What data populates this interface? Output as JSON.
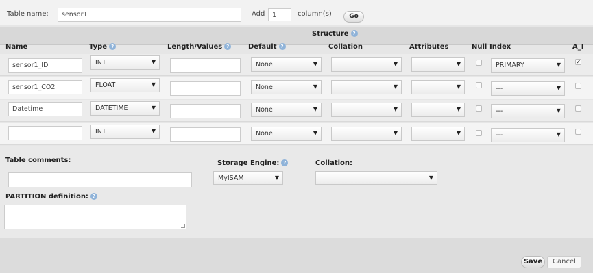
{
  "table_name": {
    "label": "Table name:",
    "value": "sensor1"
  },
  "add_columns": {
    "label": "Add",
    "value": "1",
    "suffix": "column(s)",
    "go_label": "Go"
  },
  "structure": {
    "title": "Structure",
    "headers": {
      "name": "Name",
      "type": "Type",
      "length": "Length/Values",
      "default": "Default",
      "collation": "Collation",
      "attributes": "Attributes",
      "null": "Null",
      "index": "Index",
      "ai": "A_I"
    },
    "rows": [
      {
        "name": "sensor1_ID",
        "type": "INT",
        "length": "",
        "default": "None",
        "collation": "",
        "attributes": "",
        "null": false,
        "index": "PRIMARY",
        "ai": true
      },
      {
        "name": "sensor1_CO2",
        "type": "FLOAT",
        "length": "",
        "default": "None",
        "collation": "",
        "attributes": "",
        "null": false,
        "index": "---",
        "ai": false
      },
      {
        "name": "Datetime",
        "type": "DATETIME",
        "length": "",
        "default": "None",
        "collation": "",
        "attributes": "",
        "null": false,
        "index": "---",
        "ai": false
      },
      {
        "name": "",
        "type": "INT",
        "length": "",
        "default": "None",
        "collation": "",
        "attributes": "",
        "null": false,
        "index": "---",
        "ai": false
      }
    ]
  },
  "table_comments": {
    "label": "Table comments:",
    "value": ""
  },
  "storage_engine": {
    "label": "Storage Engine:",
    "value": "MyISAM"
  },
  "table_collation": {
    "label": "Collation:",
    "value": ""
  },
  "partition": {
    "label": "PARTITION definition:",
    "value": ""
  },
  "actions": {
    "save_label": "Save",
    "cancel_label": "Cancel"
  },
  "colors": {
    "help_icon": "#8fb3d9",
    "band": "#d8d8d8",
    "footer": "#dcdcdc"
  },
  "icons": {
    "help": "help-icon",
    "dropdown": "chevron-down-icon"
  }
}
